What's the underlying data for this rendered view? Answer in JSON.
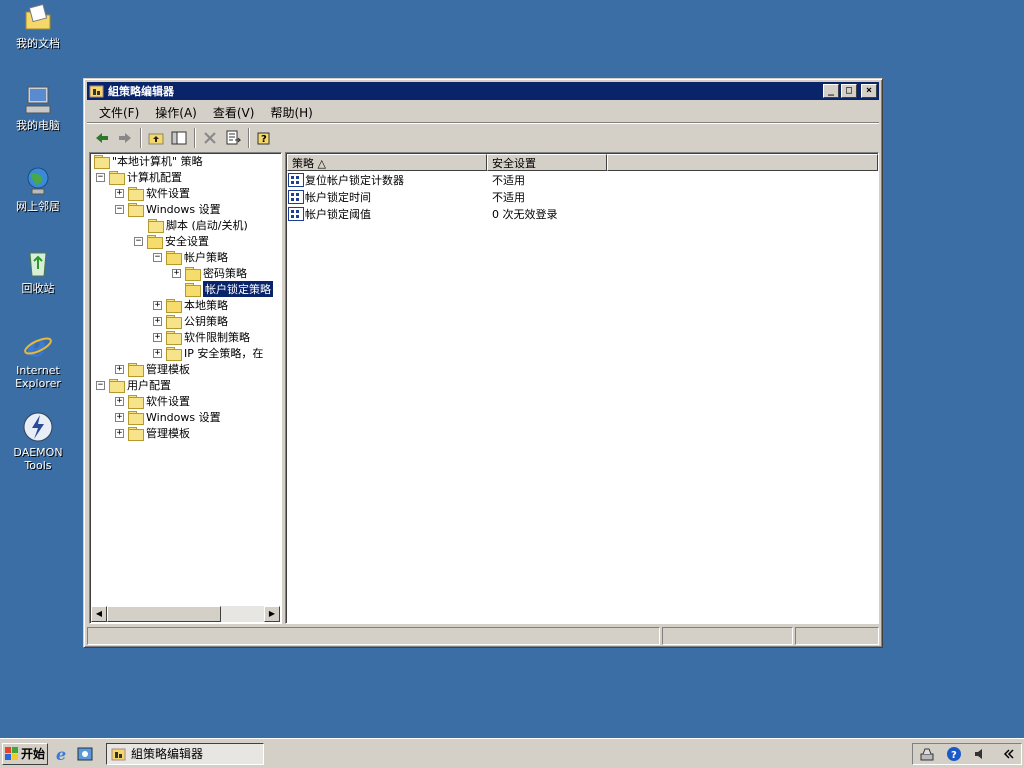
{
  "desktop": {
    "icons": [
      {
        "label": "我的文档"
      },
      {
        "label": "我的电脑"
      },
      {
        "label": "网上邻居"
      },
      {
        "label": "回收站"
      },
      {
        "label": "Internet\nExplorer"
      },
      {
        "label": "DAEMON Tools"
      }
    ]
  },
  "window": {
    "title": "組策略编辑器",
    "menu": [
      "文件(F)",
      "操作(A)",
      "查看(V)",
      "帮助(H)"
    ],
    "tree": {
      "root": "\"本地计算机\" 策略",
      "items": [
        {
          "label": "计算机配置"
        },
        {
          "label": "软件设置"
        },
        {
          "label": "Windows 设置"
        },
        {
          "label": "脚本 (启动/关机)"
        },
        {
          "label": "安全设置"
        },
        {
          "label": "帐户策略"
        },
        {
          "label": "密码策略"
        },
        {
          "label": "帐户锁定策略"
        },
        {
          "label": "本地策略"
        },
        {
          "label": "公钥策略"
        },
        {
          "label": "软件限制策略"
        },
        {
          "label": "IP 安全策略，在"
        },
        {
          "label": "管理模板"
        },
        {
          "label": "用户配置"
        },
        {
          "label": "软件设置"
        },
        {
          "label": "Windows 设置"
        },
        {
          "label": "管理模板"
        }
      ]
    },
    "list": {
      "columns": [
        "策略 △",
        "安全设置"
      ],
      "rows": [
        {
          "policy": "复位帐户锁定计数器",
          "setting": "不适用"
        },
        {
          "policy": "帐户锁定时间",
          "setting": "不适用"
        },
        {
          "policy": "帐户锁定阈值",
          "setting": "0 次无效登录"
        }
      ]
    }
  },
  "taskbar": {
    "start_label": "开始",
    "task_label": "組策略编辑器"
  },
  "colors": {
    "desktop": "#3a6ea5",
    "title_active": "#0a246a",
    "face": "#d4d0c8"
  }
}
